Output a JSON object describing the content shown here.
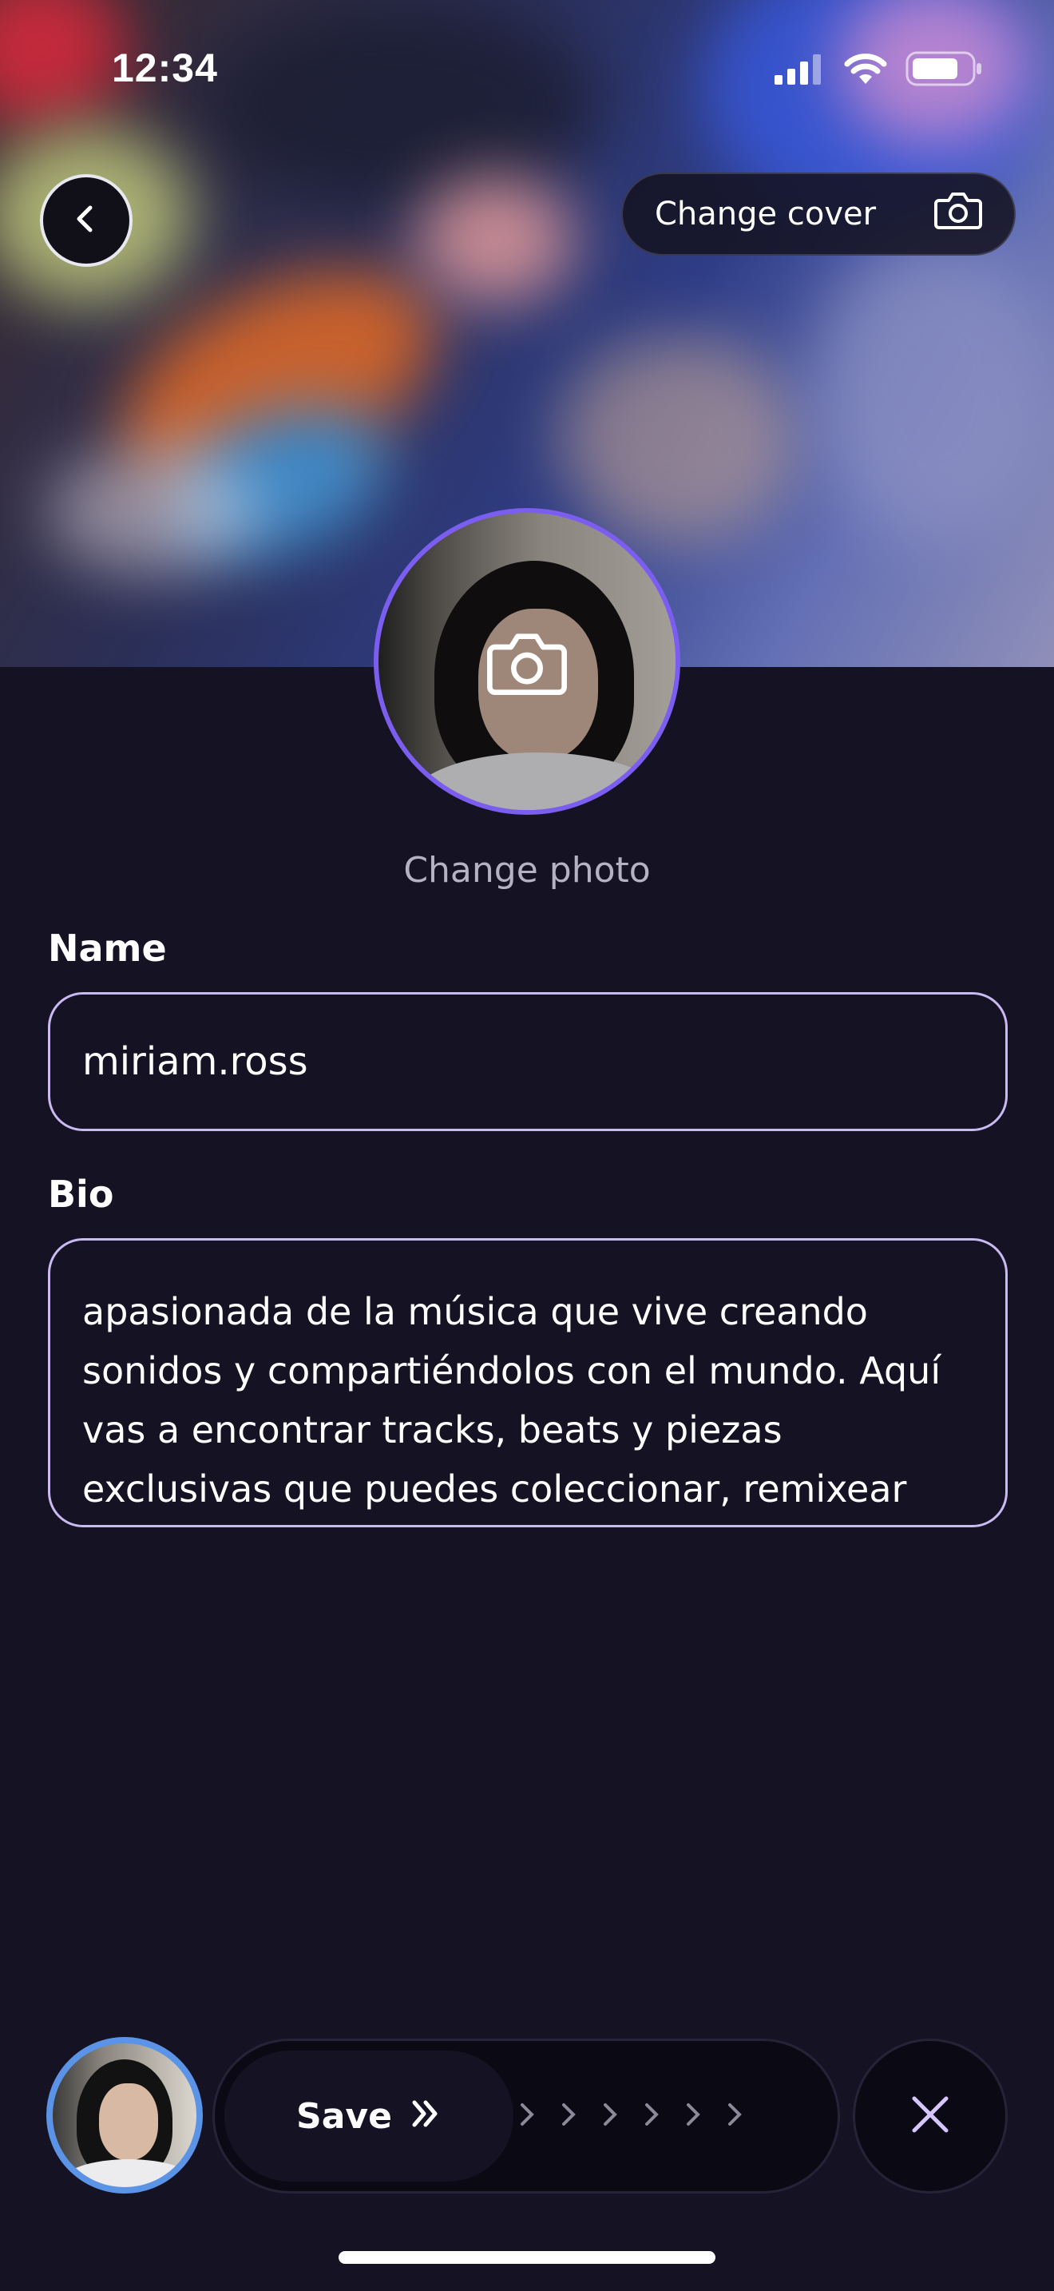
{
  "status_bar": {
    "time": "12:34"
  },
  "cover": {
    "change_cover_label": "Change cover"
  },
  "avatar": {
    "change_photo_label": "Change photo"
  },
  "form": {
    "name_label": "Name",
    "name_value": "miriam.ross",
    "bio_label": "Bio",
    "bio_value": "apasionada de la música que vive creando sonidos y compartiéndolos con el mundo. Aquí vas a encontrar tracks, beats y piezas exclusivas que puedes coleccionar, remixear"
  },
  "bottom_bar": {
    "save_label": "Save"
  },
  "colors": {
    "background": "#151223",
    "accent": "#7b5ef0",
    "field_border": "#c9baf2",
    "cancel_icon": "#d6c6ff"
  },
  "icons": [
    "chevron-left-icon",
    "camera-icon",
    "signal-icon",
    "wifi-icon",
    "battery-icon",
    "double-chevron-right-icon",
    "chevron-right-icon",
    "close-icon"
  ]
}
